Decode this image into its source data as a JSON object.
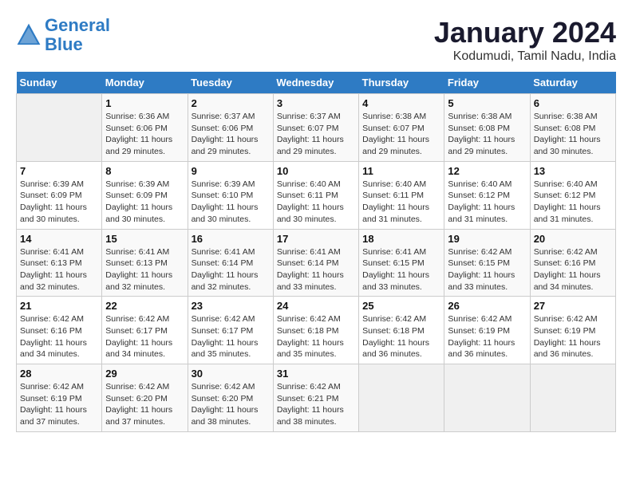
{
  "header": {
    "logo_line1": "General",
    "logo_line2": "Blue",
    "month_title": "January 2024",
    "subtitle": "Kodumudi, Tamil Nadu, India"
  },
  "weekdays": [
    "Sunday",
    "Monday",
    "Tuesday",
    "Wednesday",
    "Thursday",
    "Friday",
    "Saturday"
  ],
  "weeks": [
    [
      {
        "day": "",
        "empty": true
      },
      {
        "day": "1",
        "sunrise": "Sunrise: 6:36 AM",
        "sunset": "Sunset: 6:06 PM",
        "daylight": "Daylight: 11 hours and 29 minutes."
      },
      {
        "day": "2",
        "sunrise": "Sunrise: 6:37 AM",
        "sunset": "Sunset: 6:06 PM",
        "daylight": "Daylight: 11 hours and 29 minutes."
      },
      {
        "day": "3",
        "sunrise": "Sunrise: 6:37 AM",
        "sunset": "Sunset: 6:07 PM",
        "daylight": "Daylight: 11 hours and 29 minutes."
      },
      {
        "day": "4",
        "sunrise": "Sunrise: 6:38 AM",
        "sunset": "Sunset: 6:07 PM",
        "daylight": "Daylight: 11 hours and 29 minutes."
      },
      {
        "day": "5",
        "sunrise": "Sunrise: 6:38 AM",
        "sunset": "Sunset: 6:08 PM",
        "daylight": "Daylight: 11 hours and 29 minutes."
      },
      {
        "day": "6",
        "sunrise": "Sunrise: 6:38 AM",
        "sunset": "Sunset: 6:08 PM",
        "daylight": "Daylight: 11 hours and 30 minutes."
      }
    ],
    [
      {
        "day": "7",
        "sunrise": "Sunrise: 6:39 AM",
        "sunset": "Sunset: 6:09 PM",
        "daylight": "Daylight: 11 hours and 30 minutes."
      },
      {
        "day": "8",
        "sunrise": "Sunrise: 6:39 AM",
        "sunset": "Sunset: 6:09 PM",
        "daylight": "Daylight: 11 hours and 30 minutes."
      },
      {
        "day": "9",
        "sunrise": "Sunrise: 6:39 AM",
        "sunset": "Sunset: 6:10 PM",
        "daylight": "Daylight: 11 hours and 30 minutes."
      },
      {
        "day": "10",
        "sunrise": "Sunrise: 6:40 AM",
        "sunset": "Sunset: 6:11 PM",
        "daylight": "Daylight: 11 hours and 30 minutes."
      },
      {
        "day": "11",
        "sunrise": "Sunrise: 6:40 AM",
        "sunset": "Sunset: 6:11 PM",
        "daylight": "Daylight: 11 hours and 31 minutes."
      },
      {
        "day": "12",
        "sunrise": "Sunrise: 6:40 AM",
        "sunset": "Sunset: 6:12 PM",
        "daylight": "Daylight: 11 hours and 31 minutes."
      },
      {
        "day": "13",
        "sunrise": "Sunrise: 6:40 AM",
        "sunset": "Sunset: 6:12 PM",
        "daylight": "Daylight: 11 hours and 31 minutes."
      }
    ],
    [
      {
        "day": "14",
        "sunrise": "Sunrise: 6:41 AM",
        "sunset": "Sunset: 6:13 PM",
        "daylight": "Daylight: 11 hours and 32 minutes."
      },
      {
        "day": "15",
        "sunrise": "Sunrise: 6:41 AM",
        "sunset": "Sunset: 6:13 PM",
        "daylight": "Daylight: 11 hours and 32 minutes."
      },
      {
        "day": "16",
        "sunrise": "Sunrise: 6:41 AM",
        "sunset": "Sunset: 6:14 PM",
        "daylight": "Daylight: 11 hours and 32 minutes."
      },
      {
        "day": "17",
        "sunrise": "Sunrise: 6:41 AM",
        "sunset": "Sunset: 6:14 PM",
        "daylight": "Daylight: 11 hours and 33 minutes."
      },
      {
        "day": "18",
        "sunrise": "Sunrise: 6:41 AM",
        "sunset": "Sunset: 6:15 PM",
        "daylight": "Daylight: 11 hours and 33 minutes."
      },
      {
        "day": "19",
        "sunrise": "Sunrise: 6:42 AM",
        "sunset": "Sunset: 6:15 PM",
        "daylight": "Daylight: 11 hours and 33 minutes."
      },
      {
        "day": "20",
        "sunrise": "Sunrise: 6:42 AM",
        "sunset": "Sunset: 6:16 PM",
        "daylight": "Daylight: 11 hours and 34 minutes."
      }
    ],
    [
      {
        "day": "21",
        "sunrise": "Sunrise: 6:42 AM",
        "sunset": "Sunset: 6:16 PM",
        "daylight": "Daylight: 11 hours and 34 minutes."
      },
      {
        "day": "22",
        "sunrise": "Sunrise: 6:42 AM",
        "sunset": "Sunset: 6:17 PM",
        "daylight": "Daylight: 11 hours and 34 minutes."
      },
      {
        "day": "23",
        "sunrise": "Sunrise: 6:42 AM",
        "sunset": "Sunset: 6:17 PM",
        "daylight": "Daylight: 11 hours and 35 minutes."
      },
      {
        "day": "24",
        "sunrise": "Sunrise: 6:42 AM",
        "sunset": "Sunset: 6:18 PM",
        "daylight": "Daylight: 11 hours and 35 minutes."
      },
      {
        "day": "25",
        "sunrise": "Sunrise: 6:42 AM",
        "sunset": "Sunset: 6:18 PM",
        "daylight": "Daylight: 11 hours and 36 minutes."
      },
      {
        "day": "26",
        "sunrise": "Sunrise: 6:42 AM",
        "sunset": "Sunset: 6:19 PM",
        "daylight": "Daylight: 11 hours and 36 minutes."
      },
      {
        "day": "27",
        "sunrise": "Sunrise: 6:42 AM",
        "sunset": "Sunset: 6:19 PM",
        "daylight": "Daylight: 11 hours and 36 minutes."
      }
    ],
    [
      {
        "day": "28",
        "sunrise": "Sunrise: 6:42 AM",
        "sunset": "Sunset: 6:19 PM",
        "daylight": "Daylight: 11 hours and 37 minutes."
      },
      {
        "day": "29",
        "sunrise": "Sunrise: 6:42 AM",
        "sunset": "Sunset: 6:20 PM",
        "daylight": "Daylight: 11 hours and 37 minutes."
      },
      {
        "day": "30",
        "sunrise": "Sunrise: 6:42 AM",
        "sunset": "Sunset: 6:20 PM",
        "daylight": "Daylight: 11 hours and 38 minutes."
      },
      {
        "day": "31",
        "sunrise": "Sunrise: 6:42 AM",
        "sunset": "Sunset: 6:21 PM",
        "daylight": "Daylight: 11 hours and 38 minutes."
      },
      {
        "day": "",
        "empty": true
      },
      {
        "day": "",
        "empty": true
      },
      {
        "day": "",
        "empty": true
      }
    ]
  ]
}
